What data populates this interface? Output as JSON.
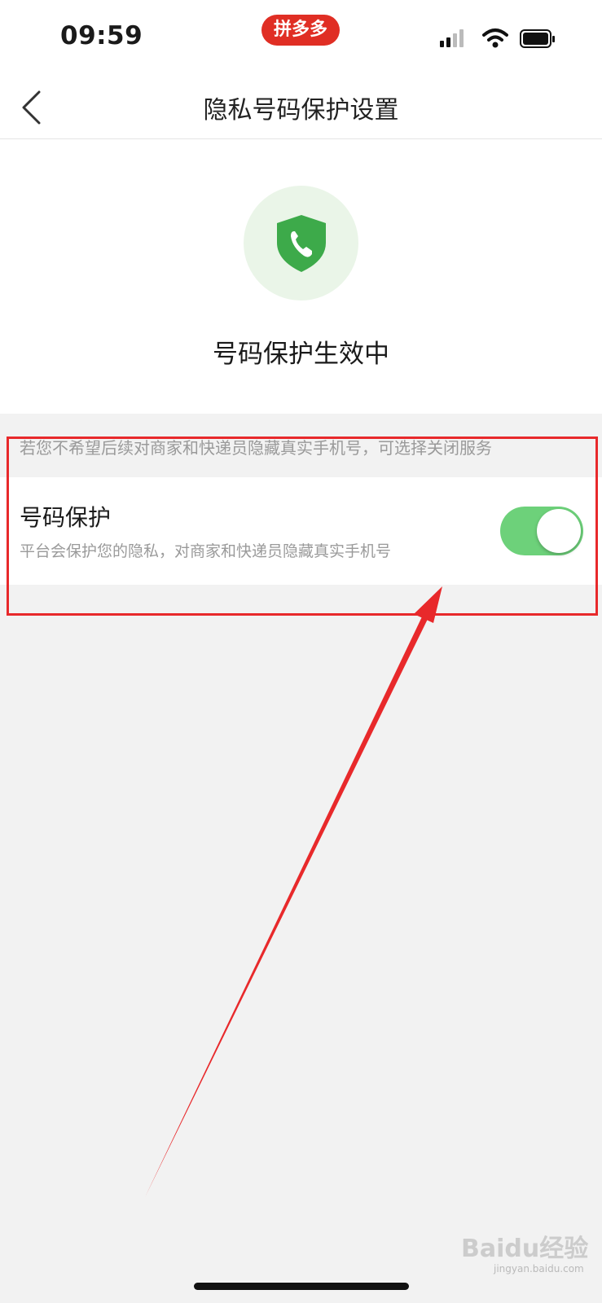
{
  "status_bar": {
    "time": "09:59",
    "app_name": "拼多多",
    "icons": [
      "signal-icon",
      "wifi-icon",
      "battery-icon"
    ]
  },
  "nav": {
    "title": "隐私号码保护设置",
    "back_icon": "back-chevron-icon"
  },
  "hero": {
    "icon": "shield-phone-icon",
    "status_text": "号码保护生效中"
  },
  "hint_text": "若您不希望后续对商家和快递员隐藏真实手机号，可选择关闭服务",
  "setting": {
    "title": "号码保护",
    "description": "平台会保护您的隐私，对商家和快递员隐藏真实手机号",
    "enabled": true
  },
  "watermark": {
    "text": "Baidu经验",
    "sub": "jingyan.baidu.com"
  },
  "colors": {
    "brand": "#e02e24",
    "toggle_on": "#6dd17a",
    "shield": "#3daa4a",
    "annotation": "#e8292b"
  }
}
